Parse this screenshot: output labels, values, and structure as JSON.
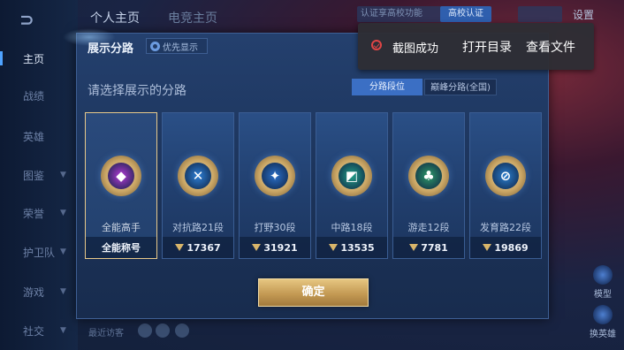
{
  "topbar": {
    "tabs": [
      "个人主页",
      "电竞主页"
    ],
    "auth_text": "认证享高校功能",
    "school_badge": "高校认证",
    "status_text": "",
    "settings_label": "设置"
  },
  "sidebar": {
    "items": [
      {
        "label": "主页",
        "active": true,
        "chevron": false
      },
      {
        "label": "战绩",
        "active": false,
        "chevron": false
      },
      {
        "label": "英雄",
        "active": false,
        "chevron": false
      },
      {
        "label": "图鉴",
        "active": false,
        "chevron": true
      },
      {
        "label": "荣誉",
        "active": false,
        "chevron": true
      },
      {
        "label": "护卫队",
        "active": false,
        "chevron": true
      },
      {
        "label": "游戏",
        "active": false,
        "chevron": true
      },
      {
        "label": "社交",
        "active": false,
        "chevron": true
      }
    ]
  },
  "right_panel": {
    "model_label": "模型",
    "swap_label": "换英雄"
  },
  "bottom": {
    "recent_visitors": "最近访客"
  },
  "dialog": {
    "title": "展示分路",
    "priority_label": "优先显示",
    "prompt": "请选择展示的分路",
    "segments": {
      "active": "分路段位",
      "inactive": "巅峰分路(全国)"
    },
    "cards": [
      {
        "name": "全能高手",
        "footer": "全能称号",
        "points": null,
        "selected": true,
        "emblem_color": "#b23ad6",
        "glyph": "◆"
      },
      {
        "name": "对抗路21段",
        "footer": "17367",
        "points": 17367,
        "selected": false,
        "emblem_color": "#2d7fd6",
        "glyph": "✕"
      },
      {
        "name": "打野30段",
        "footer": "31921",
        "points": 31921,
        "selected": false,
        "emblem_color": "#2a6fc9",
        "glyph": "✦"
      },
      {
        "name": "中路18段",
        "footer": "13535",
        "points": 13535,
        "selected": false,
        "emblem_color": "#23a08a",
        "glyph": "◩"
      },
      {
        "name": "游走12段",
        "footer": "7781",
        "points": 7781,
        "selected": false,
        "emblem_color": "#2e9a6a",
        "glyph": "♣"
      },
      {
        "name": "发育路22段",
        "footer": "19869",
        "points": 19869,
        "selected": false,
        "emblem_color": "#2b7fd0",
        "glyph": "⊘"
      }
    ],
    "confirm_label": "确定"
  },
  "toast": {
    "message": "截图成功",
    "open_folder": "打开目录",
    "view_file": "查看文件"
  }
}
